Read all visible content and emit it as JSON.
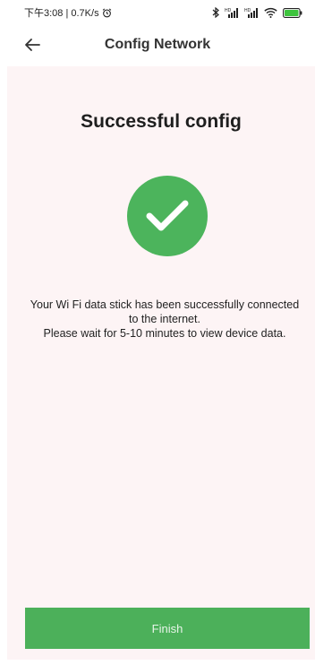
{
  "status_bar": {
    "time_speed": "下午3:08 | 0.7K/s",
    "alarm_icon": "alarm-icon",
    "bluetooth_icon": "bluetooth-icon",
    "signal_icon": "signal-icon",
    "wifi_icon": "wifi-icon",
    "battery_icon": "battery-icon",
    "signal_label": "HD"
  },
  "header": {
    "title": "Config Network",
    "back_icon": "back-arrow-icon"
  },
  "main": {
    "title": "Successful config",
    "status_icon": "checkmark-icon",
    "message_lines": [
      "Your Wi Fi data stick has been successfully connected",
      "to the internet.",
      "Please wait for 5-10 minutes to view device data."
    ],
    "finish_label": "Finish"
  },
  "colors": {
    "accent": "#4cb45c",
    "button": "#4cb05a",
    "content_bg": "#fdf4f5"
  }
}
